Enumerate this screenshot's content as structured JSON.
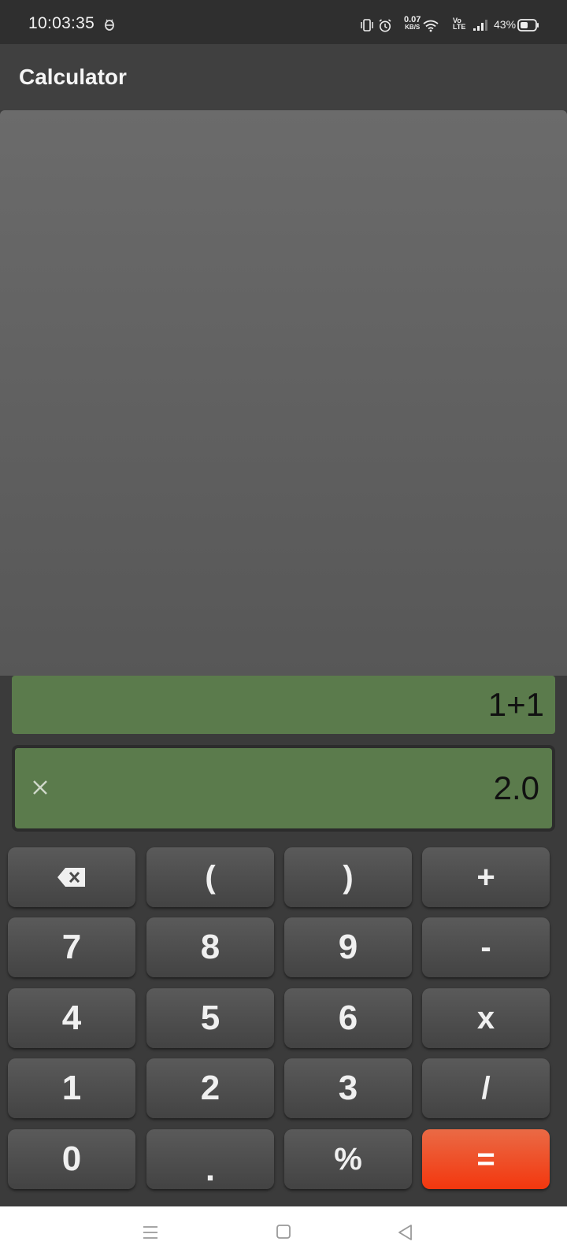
{
  "status_bar": {
    "time": "10:03:35",
    "net_speed_value": "0.07",
    "net_speed_unit": "KB/S",
    "volte_top": "Vo",
    "volte_bottom": "LTE",
    "battery_percent": "43%",
    "icons": [
      "debug-bug-icon",
      "vibrate-icon",
      "alarm-icon",
      "wifi-icon",
      "volte-icon",
      "signal-icon",
      "battery-icon"
    ]
  },
  "app_bar": {
    "title": "Calculator"
  },
  "display": {
    "expression": "1+1",
    "result": "2.0",
    "clear_icon": "close-icon",
    "field_color": "#5b7b4c"
  },
  "keypad": {
    "rows": [
      [
        "backspace-icon",
        "(",
        ")",
        "+"
      ],
      [
        "7",
        "8",
        "9",
        "-"
      ],
      [
        "4",
        "5",
        "6",
        "x"
      ],
      [
        "1",
        "2",
        "3",
        "/"
      ],
      [
        "0",
        ".",
        "%",
        "="
      ]
    ],
    "equals_color": "#f3370e"
  },
  "nav_bar": {
    "icons": [
      "menu-icon",
      "home-icon",
      "back-icon"
    ]
  }
}
